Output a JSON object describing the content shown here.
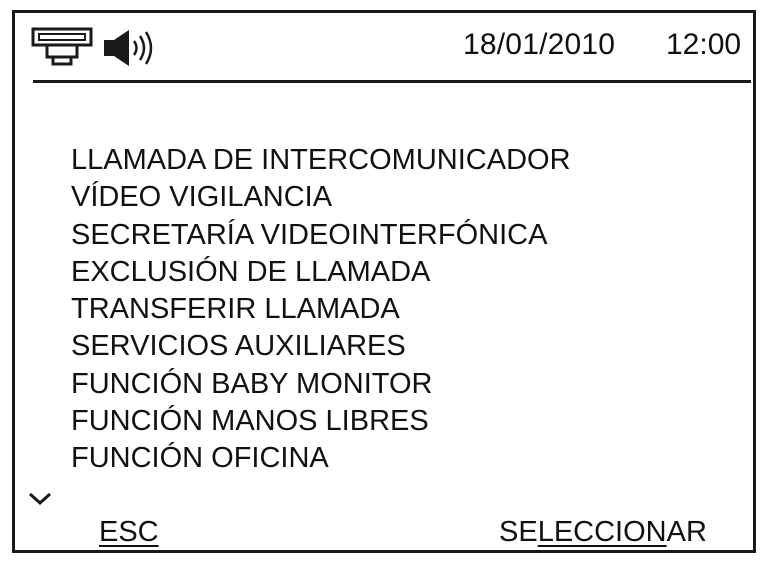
{
  "status_bar": {
    "date": "18/01/2010",
    "time": "12:00",
    "icons": [
      "intercom-icon",
      "speaker-volume-icon"
    ]
  },
  "menu": {
    "items": [
      "LLAMADA DE INTERCOMUNICADOR",
      "VÍDEO VIGILANCIA",
      "SECRETARÍA VIDEOINTERFÓNICA",
      "EXCLUSIÓN DE LLAMADA",
      "TRANSFERIR LLAMADA",
      "SERVICIOS AUXILIARES",
      "FUNCIÓN BABY MONITOR",
      "FUNCIÓN MANOS LIBRES",
      "FUNCIÓN OFICINA"
    ],
    "scroll_icon": "chevron-down-icon"
  },
  "softkeys": {
    "esc_label": "ESC",
    "select_label_prefix": "SE",
    "select_label_underlined": "LECCION",
    "select_label_suffix": "AR"
  },
  "colors": {
    "ink": "#1a1a1a",
    "background": "#ffffff"
  }
}
